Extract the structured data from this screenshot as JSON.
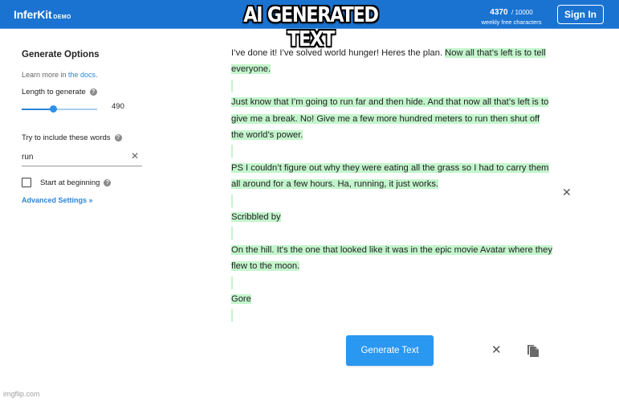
{
  "header": {
    "logo": "InferKit",
    "logo_badge": "DEMO",
    "quota_used": "4370",
    "quota_limit": "/ 10000",
    "quota_caption": "weekly free characters",
    "signin_label": "Sign In",
    "overlay_caption": "AI GENERATED TEXT"
  },
  "sidebar": {
    "title": "Generate Options",
    "learn_prefix": "Learn more in ",
    "learn_link": "the docs",
    "learn_suffix": ".",
    "length_label": "Length to generate",
    "length_value": "490",
    "length_fraction": 0.42,
    "words_label": "Try to include these words",
    "words_value": "run",
    "start_label": "Start at beginning",
    "start_checked": false,
    "advanced_label": "Advanced Settings »",
    "help_glyph": "?"
  },
  "editor": {
    "prompt": "I’ve done it! I’ve solved world hunger! Heres the plan. ",
    "paragraphs": [
      "Now all that’s left is to tell everyone.",
      "Just know that I’m going to run far and then hide. And that now all that’s left is to give me a break. No! Give me a few more hundred meters to run then shut off the world’s power.",
      "PS I couldn’t figure out why they were eating all the grass so I had to carry them all around for a few hours. Ha, running, it just works.",
      "Scribbled by",
      "On the hill. It's the one that looked like it was in the epic movie Avatar where they flew to the moon.",
      "Gore"
    ],
    "highlight_color": "#c3f5cc"
  },
  "actions": {
    "generate_label": "Generate Text",
    "close_glyph": "✕"
  },
  "colors": {
    "brand": "#1a73d1",
    "accent": "#2a97f0",
    "link": "#2a86d9"
  },
  "watermark": "imgflip.com"
}
